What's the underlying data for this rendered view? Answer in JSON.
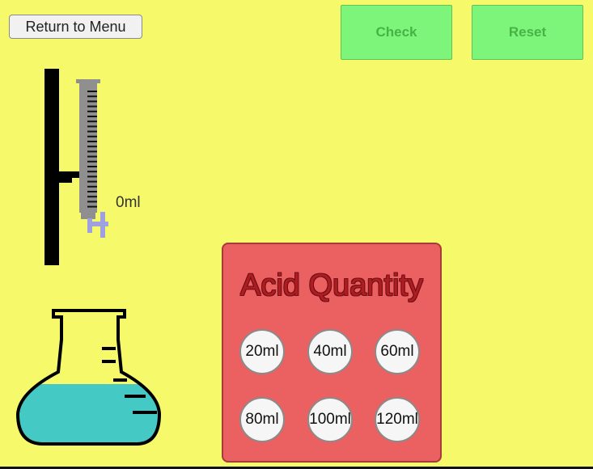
{
  "buttons": {
    "menu": "Return to Menu",
    "check": "Check",
    "reset": "Reset"
  },
  "burette": {
    "reading": "0ml"
  },
  "acid_panel": {
    "title": "Acid Quantity",
    "options": [
      "20ml",
      "40ml",
      "60ml",
      "80ml",
      "100ml",
      "120ml"
    ]
  },
  "colors": {
    "background": "#f6f96a",
    "button_green": "#7df57a",
    "panel_red": "#eb6061",
    "liquid": "#45c9c4"
  }
}
